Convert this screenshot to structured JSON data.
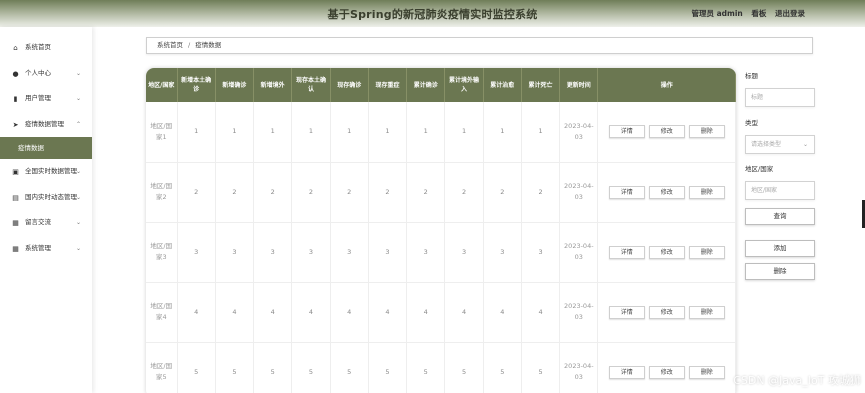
{
  "header": {
    "title": "基于Spring的新冠肺炎疫情实时监控系统",
    "user": "管理员 admin",
    "dashboard": "看板",
    "logout": "退出登录"
  },
  "sidebar": {
    "items": [
      {
        "label": "系统首页",
        "icon": "home-icon"
      },
      {
        "label": "个人中心",
        "icon": "person-icon"
      },
      {
        "label": "用户管理",
        "icon": "bar-chart-icon"
      },
      {
        "label": "疫情数据管理",
        "icon": "send-icon"
      },
      {
        "label": "疫情数据",
        "icon": ""
      },
      {
        "label": "全国实时数据管理",
        "icon": "calendar-icon"
      },
      {
        "label": "国内实时动态管理",
        "icon": "briefcase-icon"
      },
      {
        "label": "留言交流",
        "icon": "grid-icon"
      },
      {
        "label": "系统管理",
        "icon": "grid-icon"
      }
    ]
  },
  "breadcrumb": {
    "home": "系统首页",
    "separator": "/",
    "current": "疫情数据"
  },
  "table": {
    "columns": [
      "地区/国家",
      "新增本土确诊",
      "新增确诊",
      "新增境外",
      "现存本土确认",
      "现存确诊",
      "现存重症",
      "累计确诊",
      "累计境外输入",
      "累计治愈",
      "累计死亡",
      "更新时间",
      "操作"
    ],
    "rows": [
      {
        "region": "地区/国家1",
        "values": [
          "1",
          "1",
          "1",
          "1",
          "1",
          "1",
          "1",
          "1",
          "1",
          "1"
        ],
        "time": "2023-04-03"
      },
      {
        "region": "地区/国家2",
        "values": [
          "2",
          "2",
          "2",
          "2",
          "2",
          "2",
          "2",
          "2",
          "2",
          "2"
        ],
        "time": "2023-04-03"
      },
      {
        "region": "地区/国家3",
        "values": [
          "3",
          "3",
          "3",
          "3",
          "3",
          "3",
          "3",
          "3",
          "3",
          "3"
        ],
        "time": "2023-04-03"
      },
      {
        "region": "地区/国家4",
        "values": [
          "4",
          "4",
          "4",
          "4",
          "4",
          "4",
          "4",
          "4",
          "4",
          "4"
        ],
        "time": "2023-04-03"
      },
      {
        "region": "地区/国家5",
        "values": [
          "5",
          "5",
          "5",
          "5",
          "5",
          "5",
          "5",
          "5",
          "5",
          "5"
        ],
        "time": "2023-04-03"
      }
    ],
    "actions": [
      "详情",
      "修改",
      "删除"
    ]
  },
  "search": {
    "title_label": "标题",
    "title_placeholder": "标题",
    "type_label": "类型",
    "type_placeholder": "请选择类型",
    "region_label": "地区/国家",
    "region_placeholder": "地区/国家",
    "query_button": "查询",
    "add_button": "添加",
    "delete_button": "删除"
  },
  "watermark": "CSDN @Java_IoT 攻城狮",
  "colors": {
    "accent": "#6b7751",
    "header_gradient_top": "#6f7d58"
  }
}
